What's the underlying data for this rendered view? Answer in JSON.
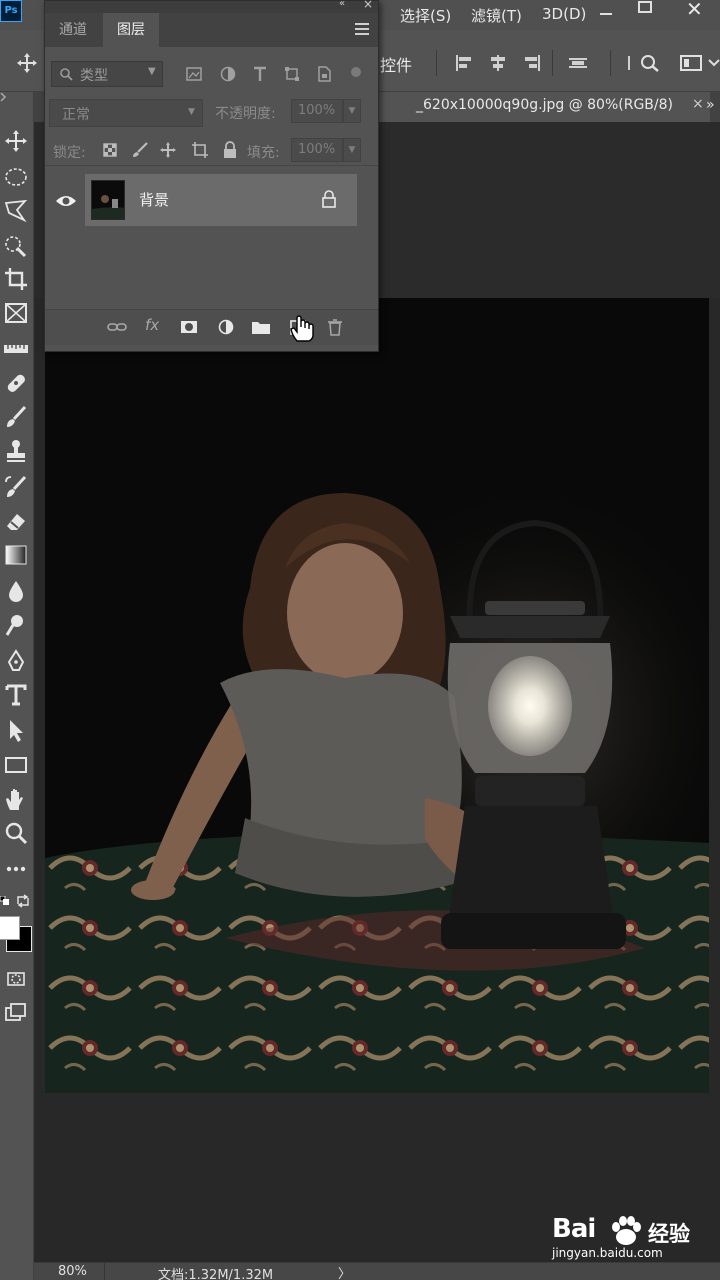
{
  "app": {
    "logo": "Ps"
  },
  "menu": {
    "items": [
      "选择(S)",
      "滤镜(T)",
      "3D(D)"
    ]
  },
  "window_controls": {
    "close": "✕"
  },
  "options_bar": {
    "controls_label": "控件"
  },
  "document": {
    "tab_title": "_620x10000q90g.jpg @ 80%(RGB/8)",
    "tab_close": "×",
    "overflow": "»"
  },
  "status": {
    "zoom": "80%",
    "doc_info": "文档:1.32M/1.32M",
    "arrow": "〉"
  },
  "layers_panel": {
    "tabs": [
      "通道",
      "图层"
    ],
    "active_tab": "图层",
    "filter": {
      "label": "类型"
    },
    "blend_mode": "正常",
    "opacity_label": "不透明度:",
    "opacity_value": "100%",
    "lock_label": "锁定:",
    "fill_label": "填充:",
    "fill_value": "100%",
    "layers": [
      {
        "name": "背景",
        "visible": true,
        "locked": true
      }
    ]
  },
  "watermark": {
    "brand": "Bai",
    "cn": "经验",
    "url": "jingyan.baidu.com"
  },
  "colors": {
    "ps_blue": "#31a8ff",
    "panel_bg": "#535353",
    "layer_selected": "#6b6b6b",
    "canvas_bg": "#282828"
  }
}
